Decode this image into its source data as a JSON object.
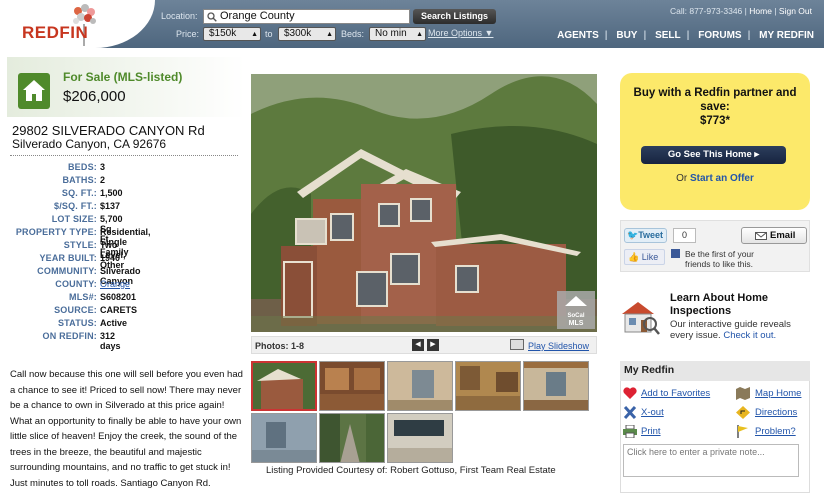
{
  "header": {
    "logo": "REDFIN",
    "location_label": "Location:",
    "location_value": "Orange County",
    "search_button": "Search Listings",
    "price_label": "Price:",
    "price_min": "$150k",
    "price_to": "to",
    "price_max": "$300k",
    "beds_label": "Beds:",
    "beds_value": "No min",
    "more_options": "More Options",
    "phone": "Call: 877-973-3346",
    "link_sep": "|",
    "home_link": "Home",
    "signout_link": "Sign Out",
    "nav": [
      "AGENTS",
      "BUY",
      "SELL",
      "FORUMS",
      "MY REDFIN"
    ]
  },
  "listing": {
    "status": "For Sale (MLS-listed)",
    "price": "$206,000",
    "address_line1": "29802 SILVERADO CANYON Rd",
    "address_line2": "Silverado Canyon, CA 92676",
    "facts": [
      {
        "label": "BEDS:",
        "value": "3"
      },
      {
        "label": "BATHS:",
        "value": "2"
      },
      {
        "label": "SQ. FT.:",
        "value": "1,500"
      },
      {
        "label": "$/SQ. FT.:",
        "value": "$137"
      },
      {
        "label": "LOT SIZE:",
        "value": "5,700 Sq. Ft."
      },
      {
        "label": "PROPERTY TYPE:",
        "value": "Residential, Single Family"
      },
      {
        "label": "STYLE:",
        "value": "Two Level, Other"
      },
      {
        "label": "YEAR BUILT:",
        "value": "1940"
      },
      {
        "label": "COMMUNITY:",
        "value": "Silverado Canyon"
      },
      {
        "label": "COUNTY:",
        "value": "Orange"
      },
      {
        "label": "MLS#:",
        "value": "S608201"
      },
      {
        "label": "SOURCE:",
        "value": "CARETS"
      },
      {
        "label": "STATUS:",
        "value": "Active"
      },
      {
        "label": "ON REDFIN:",
        "value": "312 days"
      }
    ],
    "description": "Call now because this one will sell before you even had a chance to see it! Priced to sell now! There may never be a chance to own in Silverado at this price again! What an opportunity to finally be able to have your own little slice of heaven! Enjoy the creek, the sound of the trees in the breeze, the beautiful and majestic surrounding mountains, and no traffic to get stuck in! Just minutes to toll roads. Santiago Canyon Rd."
  },
  "photos": {
    "count_label": "Photos: 1-8",
    "slideshow": "Play Slideshow",
    "mls_badge": "SoCal MLS",
    "courtesy": "Listing Provided Courtesy of: Robert Gottuso, First Team Real Estate"
  },
  "promo": {
    "title": "Buy with a Redfin partner and save:",
    "amount": "$773*",
    "button": "Go See This Home",
    "or_text": "Or",
    "offer_link": "Start an Offer"
  },
  "social": {
    "tweet": "Tweet",
    "tweet_count": "0",
    "email": "Email",
    "like": "Like",
    "like_text": "Be the first of your friends to like this."
  },
  "inspections": {
    "title": "Learn About Home Inspections",
    "body": "Our interactive guide reveals every issue.",
    "link": "Check it out."
  },
  "my_redfin": {
    "title": "My Redfin",
    "add_favorites": "Add to Favorites",
    "map_home": "Map Home",
    "xout": "X-out",
    "directions": "Directions",
    "print": "Print",
    "problem": "Problem?",
    "note_placeholder": "Click here to enter a private note..."
  },
  "colors": {
    "header_bg": "#5a7089",
    "logo_red": "#c7361f",
    "status_green": "#4f8a2b",
    "fact_label": "#4a6d9a",
    "promo_yellow": "#fce96a",
    "link_blue": "#2255aa"
  }
}
